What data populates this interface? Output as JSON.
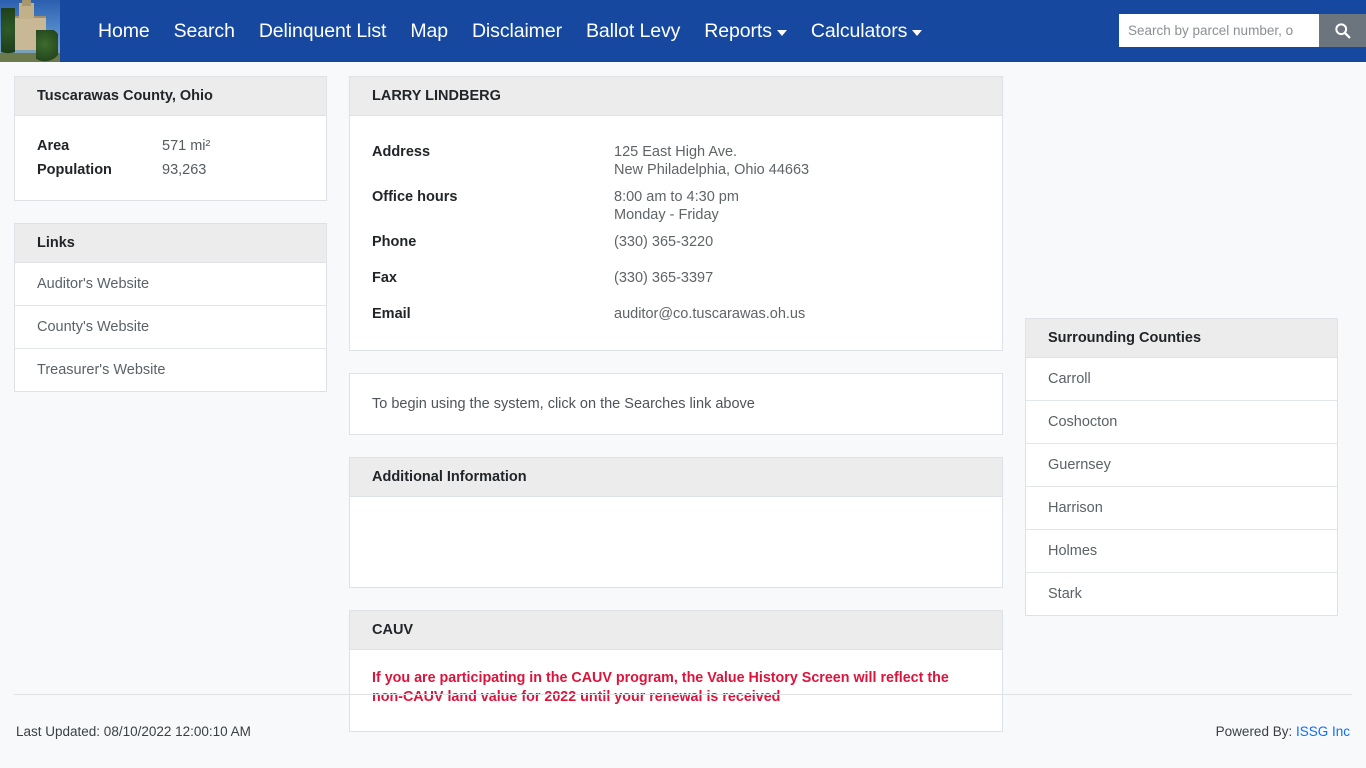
{
  "navbar": {
    "logo_alt": "county-courthouse-photo",
    "items": [
      {
        "label": "Home",
        "has_dropdown": false
      },
      {
        "label": "Search",
        "has_dropdown": false
      },
      {
        "label": "Delinquent List",
        "has_dropdown": false
      },
      {
        "label": "Map",
        "has_dropdown": false
      },
      {
        "label": "Disclaimer",
        "has_dropdown": false
      },
      {
        "label": "Ballot Levy",
        "has_dropdown": false
      },
      {
        "label": "Reports",
        "has_dropdown": true
      },
      {
        "label": "Calculators",
        "has_dropdown": true
      }
    ],
    "search": {
      "value": "",
      "placeholder": "Search by parcel number, o",
      "button_icon": "search-icon"
    },
    "accent_color": "#16489f"
  },
  "county_card": {
    "title": "Tuscarawas County, Ohio",
    "stats": [
      {
        "label": "Area",
        "value": "571 mi²"
      },
      {
        "label": "Population",
        "value": "93,263"
      }
    ]
  },
  "links_card": {
    "title": "Links",
    "items": [
      {
        "label": "Auditor's Website"
      },
      {
        "label": "County's Website"
      },
      {
        "label": "Treasurer's Website"
      }
    ]
  },
  "contact_card": {
    "title": "LARRY LINDBERG",
    "rows": [
      {
        "label": "Address",
        "value": "125 East High Ave.",
        "value2": "New Philadelphia, Ohio 44663"
      },
      {
        "label": "Office hours",
        "value": "8:00 am to 4:30 pm",
        "value2": "Monday - Friday"
      },
      {
        "label": "Phone",
        "value": "(330) 365-3220",
        "value2": ""
      },
      {
        "label": "Fax",
        "value": "(330) 365-3397",
        "value2": ""
      },
      {
        "label": "Email",
        "value": "auditor@co.tuscarawas.oh.us",
        "value2": ""
      }
    ]
  },
  "intro_card": {
    "text": "To begin using the system, click on the Searches link above"
  },
  "additional_info_card": {
    "title": "Additional Information",
    "body": ""
  },
  "cauv_card": {
    "title": "CAUV",
    "notice": "If you are participating in the CAUV program, the Value History Screen will reflect the non-CAUV land value for 2022 until your renewal is received",
    "notice_color": "#dc143c"
  },
  "surrounding_counties_card": {
    "title": "Surrounding Counties",
    "items": [
      {
        "label": "Carroll"
      },
      {
        "label": "Coshocton"
      },
      {
        "label": "Guernsey"
      },
      {
        "label": "Harrison"
      },
      {
        "label": "Holmes"
      },
      {
        "label": "Stark"
      }
    ]
  },
  "footer": {
    "last_updated": "Last Updated: 08/10/2022 12:00:10 AM",
    "powered_by_prefix": "Powered By: ",
    "powered_by_link": "ISSG Inc"
  }
}
